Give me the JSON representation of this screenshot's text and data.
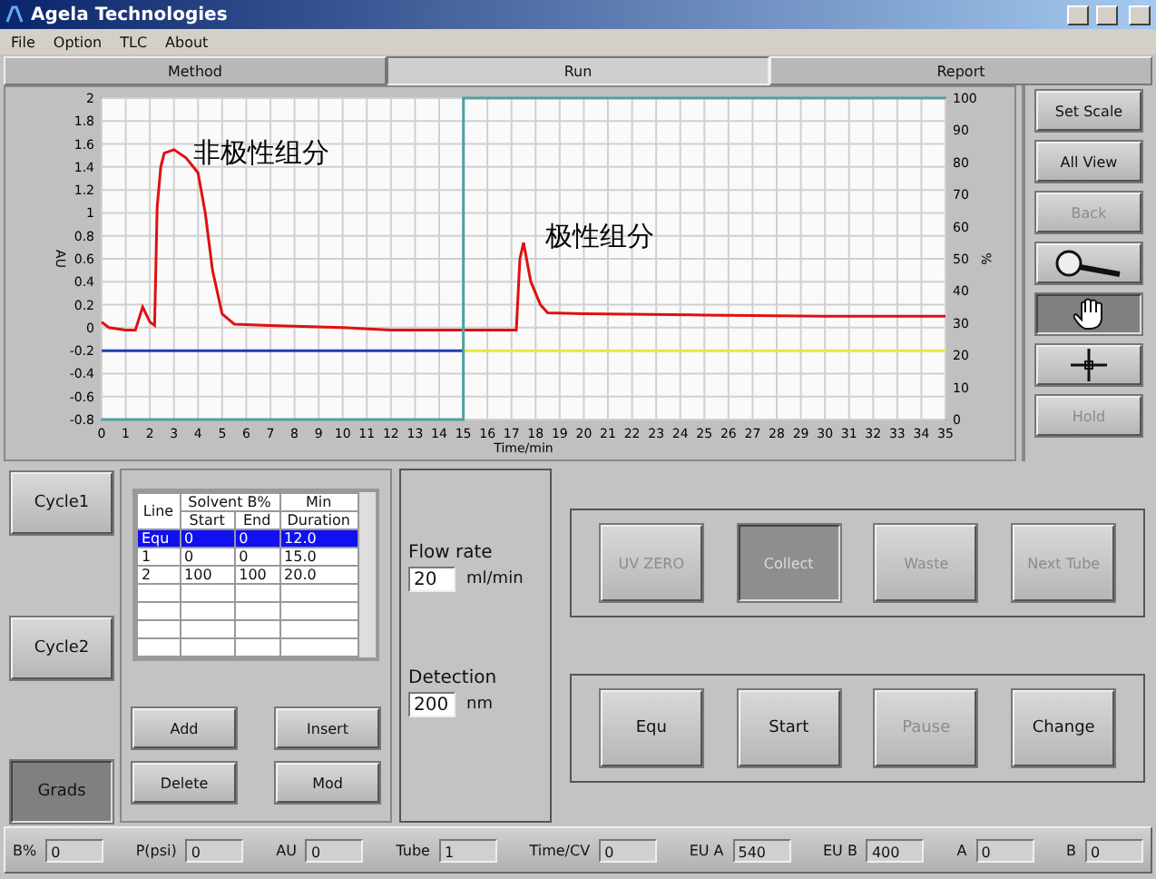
{
  "window": {
    "title": "Agela Technologies"
  },
  "menu": [
    "File",
    "Option",
    "TLC",
    "About"
  ],
  "tabs": [
    {
      "label": "Method",
      "selected": false
    },
    {
      "label": "Run",
      "selected": true
    },
    {
      "label": "Report",
      "selected": false
    }
  ],
  "chart": {
    "chart_data": {
      "type": "line",
      "grid": true,
      "xlabel": "Time/min",
      "ylabel": "AU",
      "y2label": "%",
      "xlim": [
        0,
        35
      ],
      "ylim": [
        -0.8,
        2
      ],
      "y2lim": [
        0,
        100
      ],
      "xticks": [
        0,
        1,
        2,
        3,
        4,
        5,
        6,
        7,
        8,
        9,
        10,
        11,
        12,
        13,
        14,
        15,
        16,
        17,
        18,
        19,
        20,
        21,
        22,
        23,
        24,
        25,
        26,
        27,
        28,
        29,
        30,
        31,
        32,
        33,
        34,
        35
      ],
      "yticks": [
        -0.8,
        -0.6,
        -0.4,
        -0.2,
        0,
        0.2,
        0.4,
        0.6,
        0.8,
        1,
        1.2,
        1.4,
        1.6,
        1.8,
        2
      ],
      "y2ticks": [
        0,
        10,
        20,
        30,
        40,
        50,
        60,
        70,
        80,
        90,
        100
      ],
      "x": [
        0,
        0.3,
        1,
        1.4,
        1.7,
        2,
        2.2,
        2.3,
        2.45,
        2.6,
        3,
        3.5,
        4,
        4.3,
        4.6,
        5,
        5.5,
        7,
        10,
        12,
        15,
        15.01,
        17.2,
        17.35,
        17.5,
        17.8,
        18.2,
        18.5,
        20,
        25,
        30,
        35
      ],
      "series": [
        {
          "color": "#e01010",
          "values": [
            0.05,
            0,
            -0.02,
            -0.02,
            0.18,
            0.05,
            0.02,
            1.05,
            1.4,
            1.52,
            1.55,
            1.48,
            1.35,
            1.0,
            0.5,
            0.12,
            0.03,
            0.02,
            0,
            -0.02,
            -0.02,
            -0.02,
            -0.02,
            0.6,
            0.74,
            0.4,
            0.2,
            0.13,
            0.12,
            0.11,
            0.1,
            0.1
          ]
        },
        {
          "color": "#2040b0",
          "values": [
            -0.2,
            -0.2,
            -0.2,
            -0.2,
            -0.2,
            -0.2,
            -0.2,
            -0.2,
            -0.2,
            -0.2,
            -0.2,
            -0.2,
            -0.2,
            -0.2,
            -0.2,
            -0.2,
            -0.2,
            -0.2,
            -0.2,
            -0.2,
            -0.2,
            null,
            null,
            null,
            null,
            null,
            null,
            null,
            null,
            null,
            null,
            null
          ]
        },
        {
          "color": "#e8e840",
          "values": [
            null,
            null,
            null,
            null,
            null,
            null,
            null,
            null,
            null,
            null,
            null,
            null,
            null,
            null,
            null,
            null,
            null,
            null,
            null,
            null,
            -0.2,
            -0.2,
            -0.2,
            -0.2,
            -0.2,
            -0.2,
            -0.2,
            -0.2,
            -0.2,
            -0.2,
            -0.2,
            -0.2
          ]
        },
        {
          "color": "#50a0a0",
          "values": [
            -0.8,
            -0.8,
            -0.8,
            -0.8,
            -0.8,
            -0.8,
            -0.8,
            -0.8,
            -0.8,
            -0.8,
            -0.8,
            -0.8,
            -0.8,
            -0.8,
            -0.8,
            -0.8,
            -0.8,
            -0.8,
            -0.8,
            -0.8,
            -0.8,
            2,
            2,
            2,
            2,
            2,
            2,
            2,
            2,
            2,
            2,
            2
          ]
        }
      ],
      "annotations": [
        "非极性组分",
        "极性组分"
      ]
    }
  },
  "chart_tools": [
    {
      "kind": "text",
      "label": "Set Scale",
      "disabled": false,
      "selected": false
    },
    {
      "kind": "text",
      "label": "All View",
      "disabled": false,
      "selected": false
    },
    {
      "kind": "text",
      "label": "Back",
      "disabled": true,
      "selected": false
    },
    {
      "kind": "zoom",
      "disabled": false,
      "selected": false
    },
    {
      "kind": "pan",
      "disabled": false,
      "selected": true
    },
    {
      "kind": "cursor",
      "disabled": false,
      "selected": false
    },
    {
      "kind": "text",
      "label": "Hold",
      "disabled": true,
      "selected": false
    }
  ],
  "cycles": [
    {
      "label": "Cycle1",
      "selected": false
    },
    {
      "label": "Cycle2",
      "selected": false
    },
    {
      "label": "Grads",
      "selected": true
    }
  ],
  "table": {
    "group_headers": [
      "Solvent B%",
      "Min"
    ],
    "columns": [
      "Line",
      "Start",
      "End",
      "Duration"
    ],
    "rows": [
      {
        "cells": [
          "Equ",
          "0",
          "0",
          "12.0"
        ],
        "selected": true
      },
      {
        "cells": [
          "1",
          "0",
          "0",
          "15.0"
        ],
        "selected": false
      },
      {
        "cells": [
          "2",
          "100",
          "100",
          "20.0"
        ],
        "selected": false
      }
    ]
  },
  "table_buttons": [
    "Add",
    "Insert",
    "Delete",
    "Mod"
  ],
  "flow": {
    "label": "Flow rate",
    "value": "20",
    "unit": "ml/min"
  },
  "detection": {
    "label": "Detection",
    "value": "200",
    "unit": "nm"
  },
  "fraction_buttons": [
    {
      "label": "UV ZERO",
      "disabled": true,
      "pressed": false
    },
    {
      "label": "Collect",
      "disabled": true,
      "pressed": true
    },
    {
      "label": "Waste",
      "disabled": true,
      "pressed": false
    },
    {
      "label": "Next Tube",
      "disabled": true,
      "pressed": false
    }
  ],
  "run_buttons": [
    {
      "label": "Equ",
      "disabled": false
    },
    {
      "label": "Start",
      "disabled": false
    },
    {
      "label": "Pause",
      "disabled": true
    },
    {
      "label": "Change",
      "disabled": false
    }
  ],
  "status_bar": [
    {
      "label": "B%",
      "value": "0"
    },
    {
      "label": "P(psi)",
      "value": "0"
    },
    {
      "label": "AU",
      "value": "0"
    },
    {
      "label": "Tube",
      "value": "1"
    },
    {
      "label": "Time/CV",
      "value": "0"
    },
    {
      "label": "EU A",
      "value": "540"
    },
    {
      "label": "EU B",
      "value": "400"
    },
    {
      "label": "A",
      "value": "0"
    },
    {
      "label": "B",
      "value": "0"
    }
  ]
}
